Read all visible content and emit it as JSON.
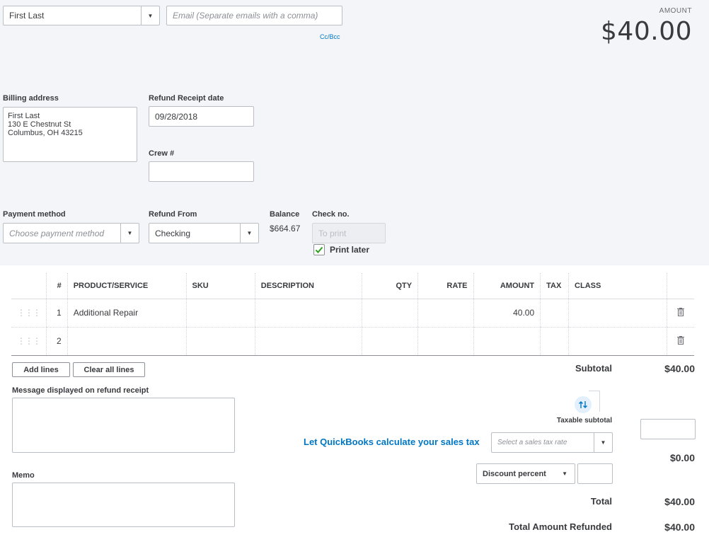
{
  "customer": {
    "name": "First Last"
  },
  "email": {
    "placeholder": "Email (Separate emails with a comma)",
    "cc_bcc": "Cc/Bcc"
  },
  "amount": {
    "label": "AMOUNT",
    "value": "$40.00"
  },
  "billing": {
    "label": "Billing address",
    "text": "First Last\n130 E Chestnut St\nColumbus, OH  43215"
  },
  "receipt_date": {
    "label": "Refund Receipt date",
    "value": "09/28/2018"
  },
  "crew": {
    "label": "Crew #",
    "value": ""
  },
  "payment_method": {
    "label": "Payment method",
    "placeholder": "Choose payment method"
  },
  "refund_from": {
    "label": "Refund From",
    "value": "Checking"
  },
  "balance": {
    "label": "Balance",
    "value": "$664.67"
  },
  "check_no": {
    "label": "Check no.",
    "placeholder": "To print"
  },
  "print_later": {
    "label": "Print later",
    "checked": true
  },
  "table": {
    "headers": [
      "#",
      "PRODUCT/SERVICE",
      "SKU",
      "DESCRIPTION",
      "QTY",
      "RATE",
      "AMOUNT",
      "TAX",
      "CLASS"
    ],
    "rows": [
      {
        "num": "1",
        "product": "Additional Repair",
        "sku": "",
        "description": "",
        "qty": "",
        "rate": "",
        "amount": "40.00",
        "tax": "",
        "class": ""
      },
      {
        "num": "2",
        "product": "",
        "sku": "",
        "description": "",
        "qty": "",
        "rate": "",
        "amount": "",
        "tax": "",
        "class": ""
      }
    ]
  },
  "buttons": {
    "add_lines": "Add lines",
    "clear_all": "Clear all lines"
  },
  "message": {
    "label": "Message displayed on refund receipt"
  },
  "memo": {
    "label": "Memo"
  },
  "totals": {
    "subtotal_label": "Subtotal",
    "subtotal_value": "$40.00",
    "taxable_label": "Taxable subtotal",
    "let_qb": "Let QuickBooks calculate your sales tax",
    "tax_rate_placeholder": "Select a sales tax rate",
    "tax_value": "$0.00",
    "discount_label": "Discount percent",
    "total_label": "Total",
    "total_value": "$40.00",
    "refunded_label": "Total Amount Refunded",
    "refunded_value": "$40.00"
  },
  "icons": {
    "sort": "swap-arrows-icon",
    "trash": "trash-icon",
    "drag": "drag-handle-icon",
    "caret": "caret-down-icon",
    "check": "checkmark-icon"
  },
  "colors": {
    "link": "#0077c5",
    "top_bg": "#f4f5f8",
    "check": "#2ca01c"
  }
}
